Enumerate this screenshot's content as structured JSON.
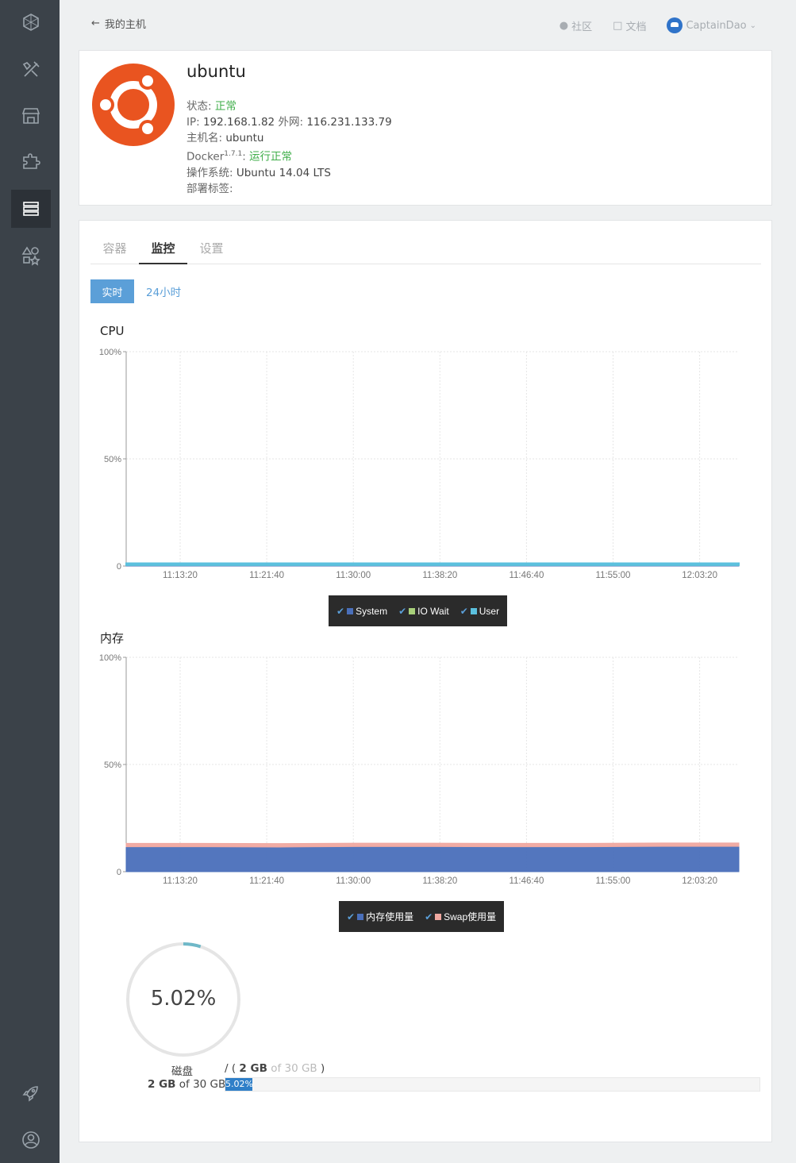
{
  "topbar": {
    "back_label": "我的主机",
    "community": "社区",
    "docs": "文档",
    "user": "CaptainDao"
  },
  "host": {
    "name": "ubuntu",
    "status_label": "状态:",
    "status_value": "正常",
    "ip_label": "IP:",
    "ip_value": "192.168.1.82",
    "wan_label": "外网:",
    "wan_value": "116.231.133.79",
    "hostname_label": "主机名:",
    "hostname_value": "ubuntu",
    "docker_label": "Docker",
    "docker_version": "1.7.1",
    "docker_status": "运行正常",
    "os_label": "操作系统:",
    "os_value": "Ubuntu 14.04 LTS",
    "tags_label": "部署标签:",
    "colors": {
      "ok": "#3fae49",
      "ubuntu": "#e95420"
    }
  },
  "tabs": [
    "容器",
    "监控",
    "设置"
  ],
  "active_tab": "监控",
  "range": {
    "realtime": "实时",
    "day": "24小时"
  },
  "chart_data": [
    {
      "type": "area",
      "title": "CPU",
      "x": [
        "11:13:20",
        "11:21:40",
        "11:30:00",
        "11:38:20",
        "11:46:40",
        "11:55:00",
        "12:03:20"
      ],
      "y_ticks": [
        "100%",
        "50%",
        "0"
      ],
      "ylim": [
        0,
        100
      ],
      "series": [
        {
          "name": "System",
          "color": "#4a6fba",
          "values": [
            0.3,
            0.3,
            0.3,
            0.3,
            0.3,
            0.3,
            0.3,
            0.3
          ]
        },
        {
          "name": "IO Wait",
          "color": "#a8d07a",
          "values": [
            0.1,
            0.1,
            0.1,
            0.1,
            0.1,
            0.1,
            0.1,
            0.1
          ]
        },
        {
          "name": "User",
          "color": "#5bc0de",
          "values": [
            0.9,
            0.9,
            0.9,
            0.9,
            0.9,
            0.9,
            0.9,
            0.9
          ]
        }
      ],
      "grid": true,
      "legend": "bottom"
    },
    {
      "type": "area",
      "title": "内存",
      "x": [
        "11:13:20",
        "11:21:40",
        "11:30:00",
        "11:38:20",
        "11:46:40",
        "11:55:00",
        "12:03:20"
      ],
      "y_ticks": [
        "100%",
        "50%",
        "0"
      ],
      "ylim": [
        0,
        100
      ],
      "series": [
        {
          "name": "内存使用量",
          "color": "#4a6fba",
          "values": [
            11.6,
            11.6,
            11.5,
            11.7,
            11.7,
            11.6,
            11.6,
            11.8,
            11.8
          ]
        },
        {
          "name": "Swap使用量",
          "color": "#f0a8a0",
          "values": [
            1.6,
            1.6,
            1.6,
            1.6,
            1.6,
            1.6,
            1.6,
            1.6,
            1.6
          ]
        }
      ],
      "grid": true,
      "legend": "bottom"
    }
  ],
  "disk": {
    "percent": 5.02,
    "percent_label": "5.02%",
    "label": "磁盘",
    "path": "/",
    "used": "2 GB",
    "of_text": "of",
    "total": "30 GB",
    "colors": {
      "ring": "#6fb8c8",
      "track": "#e5e5e5",
      "bar": "#2f7fc8"
    }
  }
}
